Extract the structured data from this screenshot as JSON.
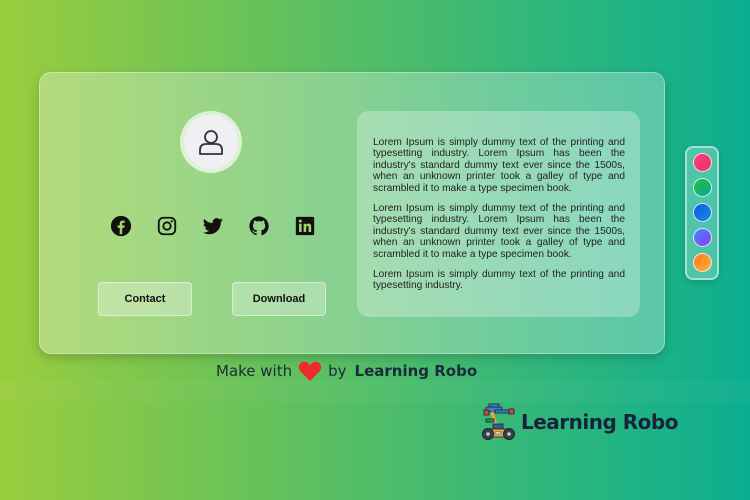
{
  "profile": {
    "avatar_icon": "user-icon"
  },
  "socials": [
    {
      "name": "facebook",
      "icon": "facebook-icon"
    },
    {
      "name": "instagram",
      "icon": "instagram-icon"
    },
    {
      "name": "twitter",
      "icon": "twitter-icon"
    },
    {
      "name": "github",
      "icon": "github-icon"
    },
    {
      "name": "linkedin",
      "icon": "linkedin-icon"
    }
  ],
  "buttons": {
    "contact_label": "Contact",
    "download_label": "Download"
  },
  "paragraphs": [
    "Lorem Ipsum is simply dummy text of the printing and typesetting industry. Lorem Ipsum has been the industry's standard dummy text ever since the 1500s, when an unknown printer took a galley of type and scrambled it to make a type specimen book.",
    "Lorem Ipsum is simply dummy text of the printing and typesetting industry. Lorem Ipsum has been the industry's standard dummy text ever since the 1500s, when an unknown printer took a galley of type and scrambled it to make a type specimen book.",
    "Lorem Ipsum is simply dummy text of the printing and typesetting industry."
  ],
  "palette": {
    "swatches": [
      {
        "name": "pink",
        "from": "#ff3d7f",
        "to": "#e8336a"
      },
      {
        "name": "green",
        "from": "#1fbf4a",
        "to": "#0aa88a"
      },
      {
        "name": "blue",
        "from": "#0a5ae0",
        "to": "#1a8ae8"
      },
      {
        "name": "violet",
        "from": "#3d8cff",
        "to": "#8a3cf0"
      },
      {
        "name": "orange",
        "from": "#ff7a1a",
        "to": "#ffb03a"
      }
    ]
  },
  "footer": {
    "made_with": "Make with",
    "by": "by",
    "brand": "Learning Robo",
    "heart_color": "#ee2a2a"
  },
  "logo": {
    "text": "Learning Robo"
  }
}
